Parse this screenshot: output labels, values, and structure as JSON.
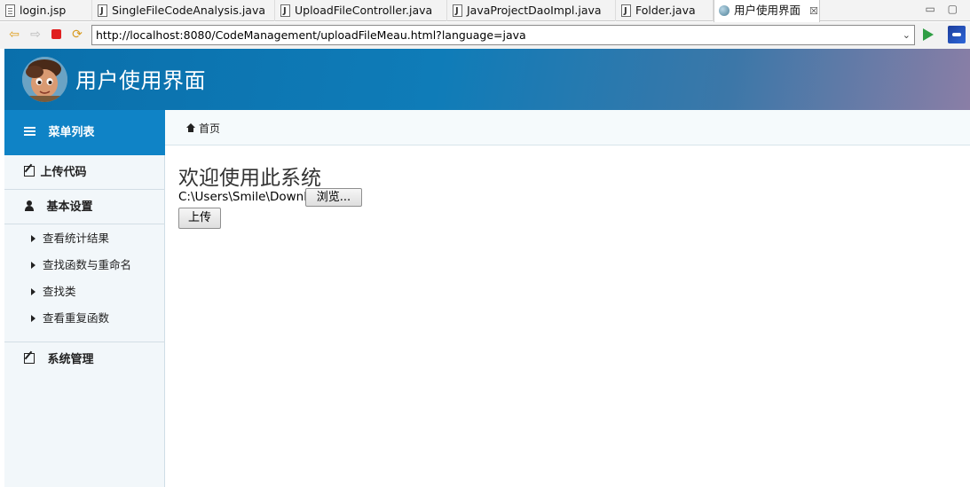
{
  "editor_tabs": [
    {
      "label": "login.jsp",
      "icon": "file-icon"
    },
    {
      "label": "SingleFileCodeAnalysis.java",
      "icon": "java-file-icon"
    },
    {
      "label": "UploadFileController.java",
      "icon": "java-file-icon"
    },
    {
      "label": "JavaProjectDaoImpl.java",
      "icon": "java-file-icon"
    },
    {
      "label": "Folder.java",
      "icon": "java-file-icon"
    },
    {
      "label": "用户使用界面",
      "icon": "globe-icon",
      "active": true,
      "close": "☒"
    }
  ],
  "window_controls": {
    "minimize": "▭",
    "maximize": "▢"
  },
  "browser": {
    "url": "http://localhost:8080/CodeManagement/uploadFileMeau.html?language=java",
    "dropdown": "⌄"
  },
  "header": {
    "title": "用户使用界面"
  },
  "sidebar": {
    "header_label": "菜单列表",
    "upload_label": "上传代码",
    "settings_label": "基本设置",
    "sub_items": [
      "查看统计结果",
      "查找函数与重命名",
      "查找类",
      "查看重复函数"
    ],
    "system_label": "系统管理"
  },
  "breadcrumb": {
    "home": "首页"
  },
  "main": {
    "welcome": "欢迎使用此系统",
    "file_path": "C:\\Users\\Smile\\Downloads",
    "browse_label": "浏览...",
    "upload_label": "上传"
  },
  "colors": {
    "header_blue": "#0f7cb8",
    "sidebar_header": "#0f83c6",
    "sidebar_bg": "#f2f7fa"
  }
}
